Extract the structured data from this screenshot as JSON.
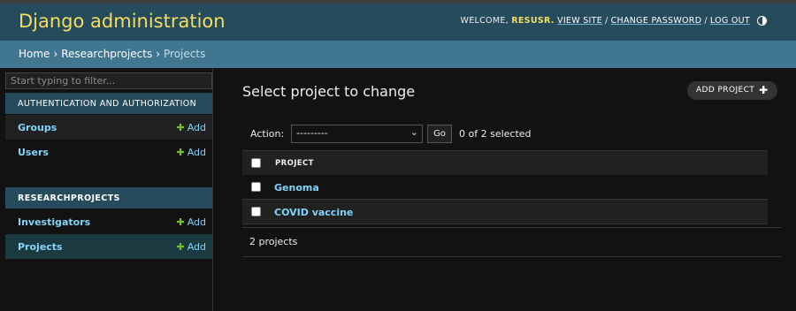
{
  "header": {
    "brand": "Django administration",
    "welcome": "WELCOME,",
    "username": "RESUSR.",
    "links": [
      "VIEW SITE",
      "CHANGE PASSWORD",
      "LOG OUT"
    ],
    "theme_icon": "contrast-icon"
  },
  "breadcrumbs": [
    "Home",
    "Researchprojects",
    "Projects"
  ],
  "sidebar": {
    "filter_placeholder": "Start typing to filter...",
    "apps": [
      {
        "caption": "AUTHENTICATION AND AUTHORIZATION",
        "models": [
          {
            "name": "Groups",
            "add": "Add"
          },
          {
            "name": "Users",
            "add": "Add"
          }
        ]
      },
      {
        "caption": "RESEARCHPROJECTS",
        "models": [
          {
            "name": "Investigators",
            "add": "Add"
          },
          {
            "name": "Projects",
            "add": "Add"
          }
        ]
      }
    ]
  },
  "main": {
    "title": "Select project to change",
    "add_button": "ADD PROJECT",
    "action_label": "Action:",
    "action_selected": "---------",
    "go_button": "Go",
    "selected_counter": "0 of 2 selected",
    "column_header": "PROJECT",
    "rows": [
      "Genoma",
      "COVID vaccine"
    ],
    "paginator": "2 projects"
  },
  "colors": {
    "header_bg": "#264b5d",
    "breadcrumb_bg": "#417690",
    "brand_yellow": "#f5dd5d",
    "link_blue": "#81d4fa",
    "add_green": "#70bf2b"
  }
}
